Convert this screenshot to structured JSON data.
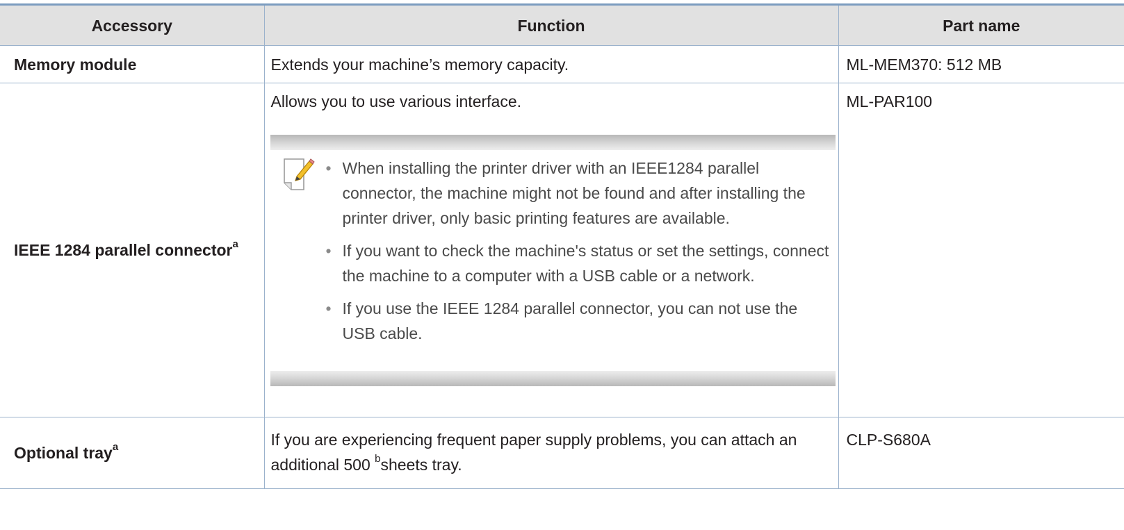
{
  "table": {
    "headers": {
      "accessory": "Accessory",
      "function": "Function",
      "part_name": "Part name"
    },
    "rows": [
      {
        "accessory": "Memory module",
        "accessory_sup": "",
        "function": "Extends your machine’s memory capacity.",
        "part_name": "ML-MEM370: 512 MB"
      },
      {
        "accessory": "IEEE 1284 parallel connector",
        "accessory_sup": "a",
        "function": "Allows you to use various interface.",
        "part_name": "ML-PAR100",
        "note": {
          "icon": "note-pencil-icon",
          "items": [
            "When installing the printer driver with an IEEE1284 parallel connector, the machine might not be found and after installing the printer driver, only basic printing features are available.",
            "If you want to check the machine's status or set the settings, connect the machine to a computer with a USB cable or a network.",
            "If you use the IEEE 1284 parallel connector, you can not use the USB cable."
          ]
        }
      },
      {
        "accessory": "Optional tray",
        "accessory_sup": "a",
        "function_before": "If you are experiencing frequent paper supply problems, you can attach an additional 500 ",
        "function_sup": "b",
        "function_after": "sheets tray.",
        "part_name": "CLP-S680A"
      }
    ]
  },
  "colors": {
    "header_bg": "#e1e1e1",
    "rule": "#7b9cbf",
    "border": "#9bb2cc",
    "text": "#231f20",
    "note_text": "#4a4a4a"
  }
}
